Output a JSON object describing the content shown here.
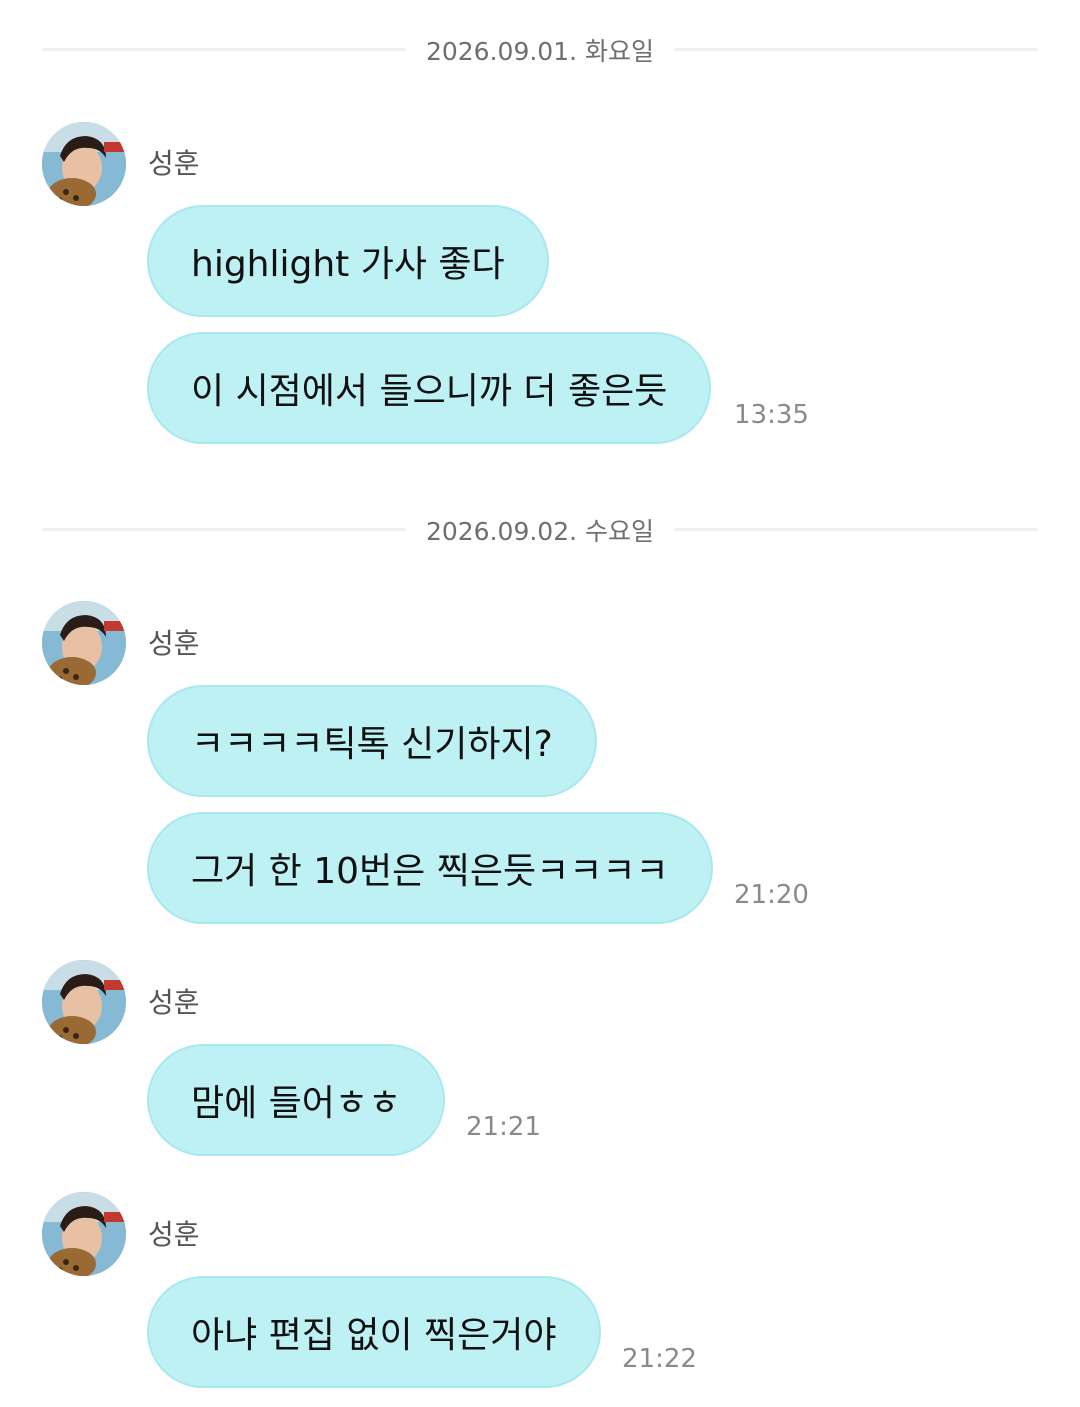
{
  "dates": [
    "2026.09.01. 화요일",
    "2026.09.02. 수요일"
  ],
  "sender_name": "성훈",
  "messages": [
    {
      "text": "highlight 가사 좋다"
    },
    {
      "text": "이 시점에서 들으니까 더 좋은듯",
      "time": "13:35"
    },
    {
      "text": "ㅋㅋㅋㅋ틱톡 신기하지?"
    },
    {
      "text": "그거 한 10번은 찍은듯ㅋㅋㅋㅋ",
      "time": "21:20"
    },
    {
      "text": "맘에 들어ㅎㅎ",
      "time": "21:21"
    },
    {
      "text": "아냐 편집 없이 찍은거야",
      "time": "21:22"
    }
  ],
  "colors": {
    "bubble": "#bdf1f4",
    "bubble_border": "#a9e8ee",
    "timestamp": "#8a8a8a",
    "date_text": "#6f6f6f",
    "divider": "#f1f1f1"
  },
  "icons": {
    "avatar": "profile-photo"
  }
}
